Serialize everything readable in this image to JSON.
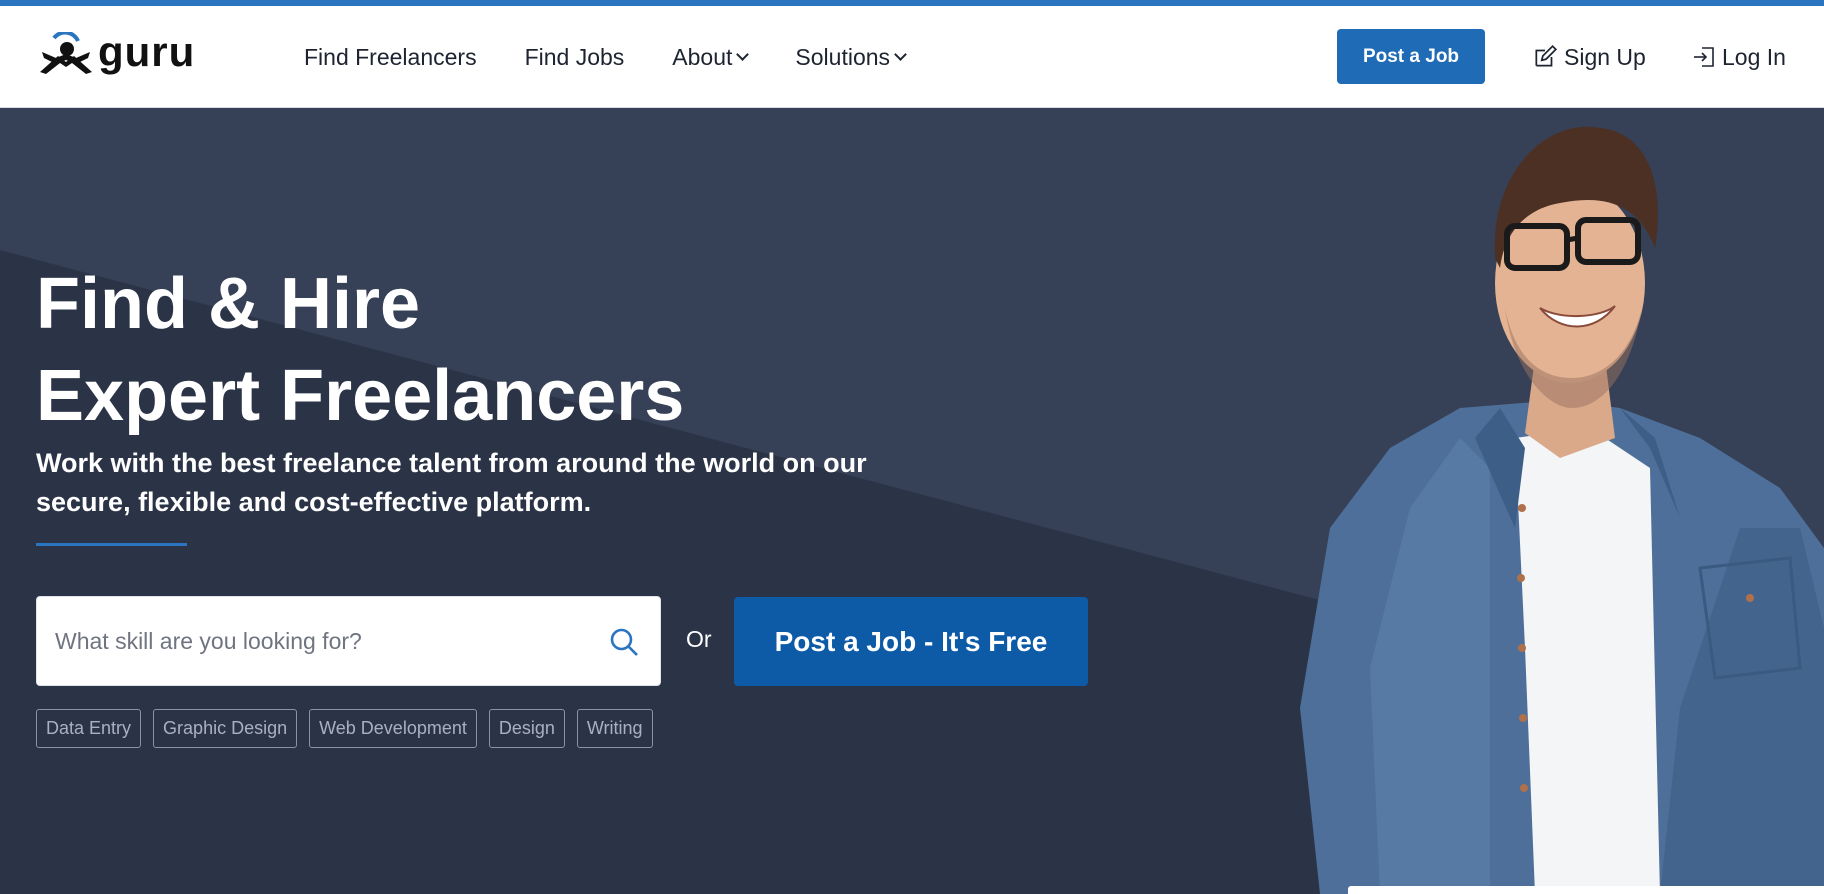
{
  "brand": {
    "logo_text": "guru",
    "colors": {
      "primary": "#1f6bb5",
      "cta": "#0d5ba7",
      "hero_bg": "#2b3347",
      "stripe": "#2b74bf"
    }
  },
  "nav": {
    "links": [
      {
        "label": "Find Freelancers"
      },
      {
        "label": "Find Jobs"
      },
      {
        "label": "About"
      },
      {
        "label": "Solutions"
      }
    ],
    "post_job_label": "Post a Job",
    "signup_label": "Sign Up",
    "login_label": "Log In",
    "icons": {
      "signup": "edit-icon",
      "login": "login-icon"
    }
  },
  "hero": {
    "headline_line1": "Find & Hire",
    "headline_line2": "Expert Freelancers",
    "subhead": "Work with the best freelance talent from around the world on our secure, flexible and cost-effective platform.",
    "search": {
      "placeholder": "What skill are you looking for?",
      "value": "",
      "icon": "search-icon"
    },
    "or_text": "Or",
    "cta_label": "Post a Job - It's Free",
    "tags": [
      "Data Entry",
      "Graphic Design",
      "Web Development",
      "Design",
      "Writing"
    ]
  }
}
